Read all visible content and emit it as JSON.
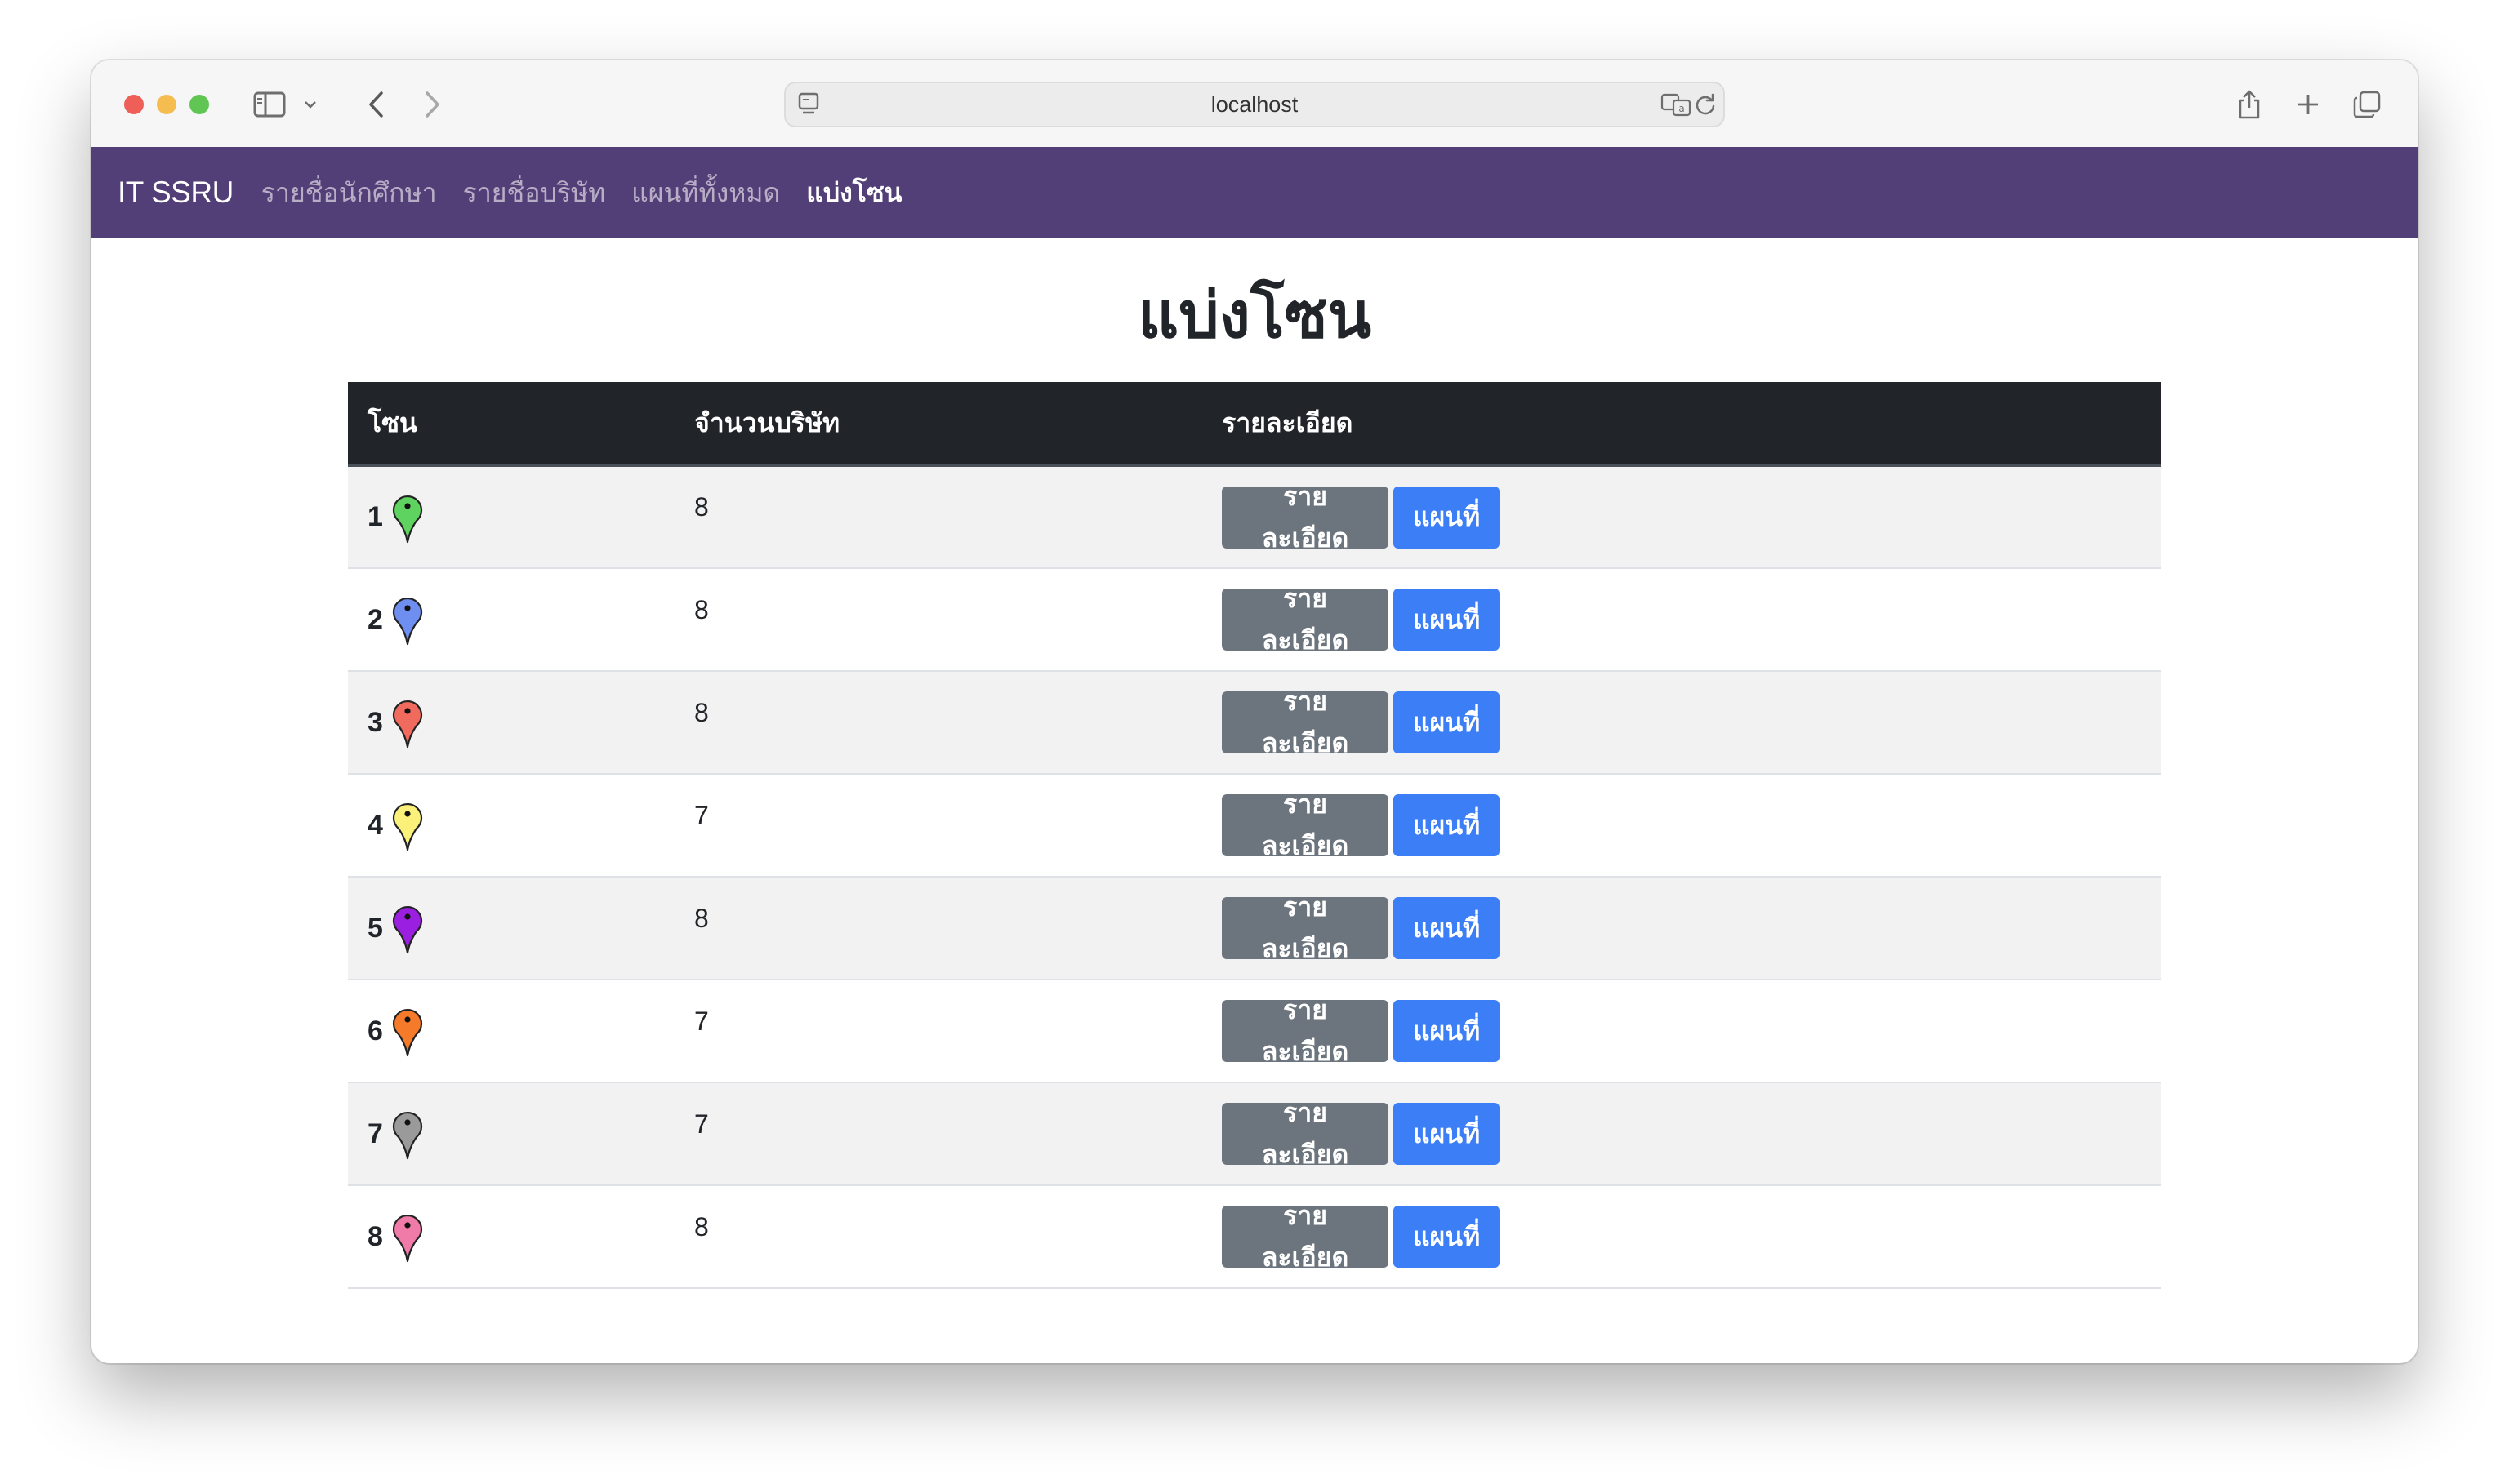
{
  "browser": {
    "url": "localhost"
  },
  "navbar": {
    "brand": "IT SSRU",
    "links": [
      {
        "label": "รายชื่อนักศึกษา",
        "active": false
      },
      {
        "label": "รายชื่อบริษัท",
        "active": false
      },
      {
        "label": "แผนที่ทั้งหมด",
        "active": false
      },
      {
        "label": "แบ่งโซน",
        "active": true
      }
    ]
  },
  "page": {
    "title": "แบ่งโซน"
  },
  "table": {
    "headers": [
      "โซน",
      "จำนวนบริษัท",
      "รายละเอียด"
    ],
    "detail_button_label": "รายละเอียด",
    "map_button_label": "แผนที่",
    "rows": [
      {
        "zone": "1",
        "count": "8",
        "pin_color": "#5fd35f"
      },
      {
        "zone": "2",
        "count": "8",
        "pin_color": "#6f8ff0"
      },
      {
        "zone": "3",
        "count": "8",
        "pin_color": "#f06a5e"
      },
      {
        "zone": "4",
        "count": "7",
        "pin_color": "#fbf07a"
      },
      {
        "zone": "5",
        "count": "8",
        "pin_color": "#9a1fe0"
      },
      {
        "zone": "6",
        "count": "7",
        "pin_color": "#f57a2a"
      },
      {
        "zone": "7",
        "count": "7",
        "pin_color": "#9a9a9a"
      },
      {
        "zone": "8",
        "count": "8",
        "pin_color": "#f07aa8"
      }
    ]
  },
  "colors": {
    "navbar_bg": "#533f78",
    "table_header_bg": "#212529",
    "detail_button": "#6c757d",
    "map_button": "#3b7ef5"
  },
  "icons": [
    "sidebar-icon",
    "chevron-down-icon",
    "back-icon",
    "forward-icon",
    "page-icon",
    "translate-icon",
    "reload-icon",
    "share-icon",
    "new-tab-icon",
    "tabs-icon",
    "map-pin-icon"
  ]
}
